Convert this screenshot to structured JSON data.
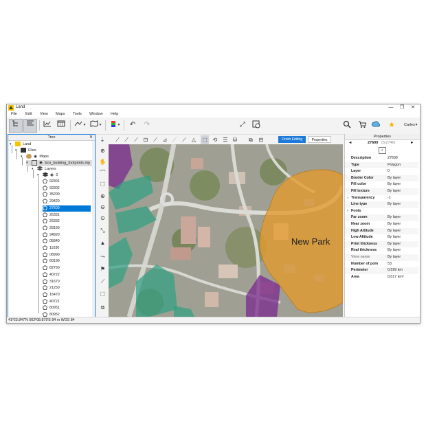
{
  "window": {
    "title": "Land",
    "controls": {
      "minimize": "—",
      "maximize": "❐",
      "close": "✕"
    }
  },
  "menu": [
    "File",
    "Edit",
    "View",
    "Maps",
    "Tools",
    "Window",
    "Help"
  ],
  "toolbar": {
    "user": "Carles"
  },
  "tree": {
    "title": "Tree",
    "close": "✕",
    "nodes": [
      {
        "label": "Land"
      },
      {
        "label": "Files"
      },
      {
        "label": "Maps"
      },
      {
        "label": "bcn_building_footprints.mp",
        "close": "✕"
      },
      {
        "label": "Layers"
      },
      {
        "label": "0"
      }
    ],
    "layers": [
      "92301",
      "92302",
      "35200",
      "29420",
      "27600",
      "26331",
      "26332",
      "28160",
      "94920",
      "05840",
      "11030",
      "08990",
      "60190",
      "82750",
      "40722",
      "31670",
      "21250",
      "15470",
      "40721",
      "80951",
      "80952"
    ],
    "selected_layer": "27600"
  },
  "edit_toolbar": {
    "finish_label": "Finish Editing",
    "properties_label": "Properties"
  },
  "map": {
    "label": "New Park"
  },
  "properties": {
    "title": "Properties",
    "prev": "◄",
    "next": "►",
    "current": "27600",
    "counter": "(5/2746)",
    "rows": [
      {
        "key": "Description",
        "value": "27600"
      },
      {
        "key": "Type",
        "value": "Polygon"
      },
      {
        "key": "Layer",
        "value": "0"
      },
      {
        "key": "Border Color",
        "value": "By layer"
      },
      {
        "key": "Fill color",
        "value": "By layer"
      },
      {
        "key": "Fill texture",
        "value": "By layer"
      },
      {
        "key": "Transparency",
        "value": "-1"
      },
      {
        "key": "Line type",
        "value": "By layer"
      },
      {
        "key": "Fonts",
        "value": ""
      },
      {
        "key": "Far zoom",
        "value": "By layer"
      },
      {
        "key": "Near zoom",
        "value": "By layer"
      },
      {
        "key": "High Altitude",
        "value": "By layer"
      },
      {
        "key": "Low Altitude",
        "value": "By layer"
      },
      {
        "key": "Print thickness",
        "value": "By layer"
      },
      {
        "key": "Real thickness",
        "value": "By layer"
      },
      {
        "key": "View name",
        "value": "By layer"
      },
      {
        "key": "Number of poin",
        "value": "53"
      },
      {
        "key": "Perimeter",
        "value": "0,599 km"
      },
      {
        "key": "Area",
        "value": "0,017 km²"
      }
    ]
  },
  "status": {
    "text": "41º23.847'N 002º08.879'E   84 m   WGS 84"
  },
  "colors": {
    "accent": "#1e7ad8",
    "selection": "#0078d7",
    "park_fill": "#e39a2c",
    "green_zone": "#2f9f83",
    "purple_zone": "#7a2a8f"
  }
}
